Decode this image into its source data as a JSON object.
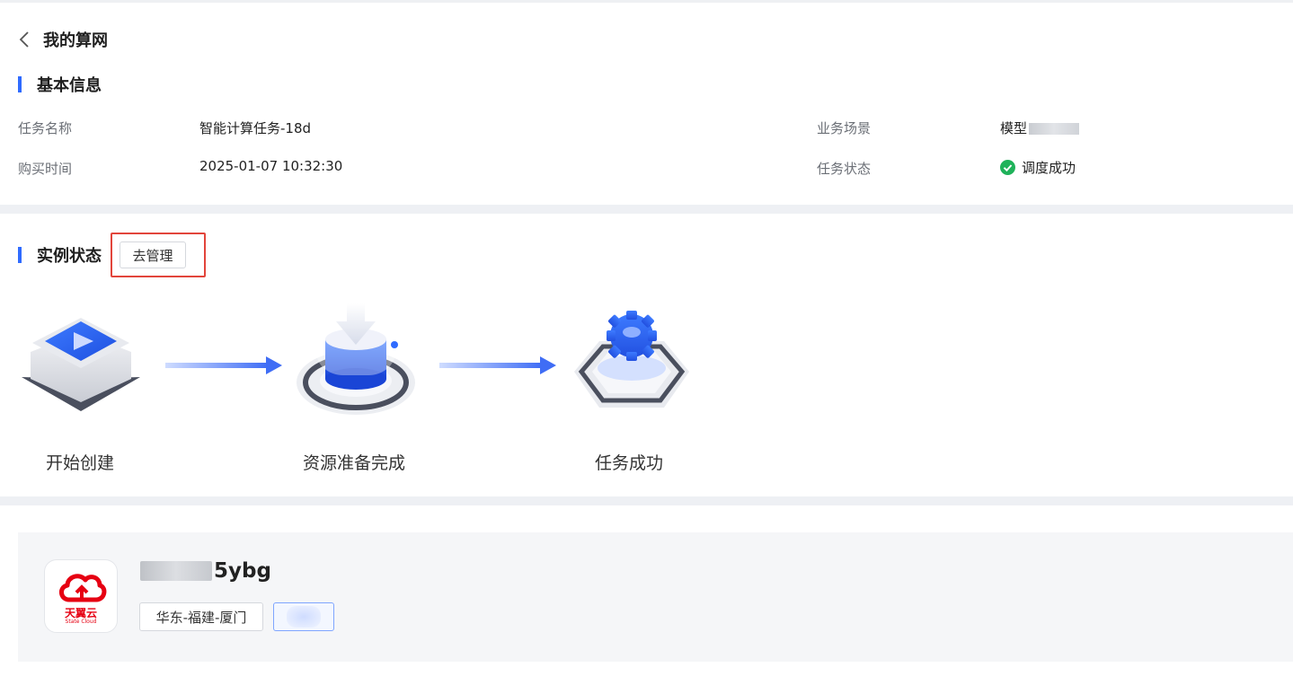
{
  "header": {
    "page_title": "我的算网"
  },
  "basic_info": {
    "section_title": "基本信息",
    "task_name_label": "任务名称",
    "task_name_value": "智能计算任务-18d",
    "purchase_time_label": "购买时间",
    "purchase_time_value": "2025-01-07 10:32:30",
    "scenario_label": "业务场景",
    "scenario_value": "模型",
    "status_label": "任务状态",
    "status_value": "调度成功",
    "status_color": "#1fb25a"
  },
  "instance_status": {
    "section_title": "实例状态",
    "manage_button": "去管理",
    "steps": [
      {
        "label": "开始创建",
        "icon": "start-create-icon"
      },
      {
        "label": "资源准备完成",
        "icon": "resource-ready-icon"
      },
      {
        "label": "任务成功",
        "icon": "task-success-icon"
      }
    ]
  },
  "resource_card": {
    "name_suffix": "5ybg",
    "logo_text": "天翼云",
    "logo_subtext": "State Cloud",
    "region_tag": "华东-福建-厦门"
  },
  "colors": {
    "accent": "#2f6bff",
    "highlight": "#e2453b",
    "logo_red": "#e60012"
  }
}
